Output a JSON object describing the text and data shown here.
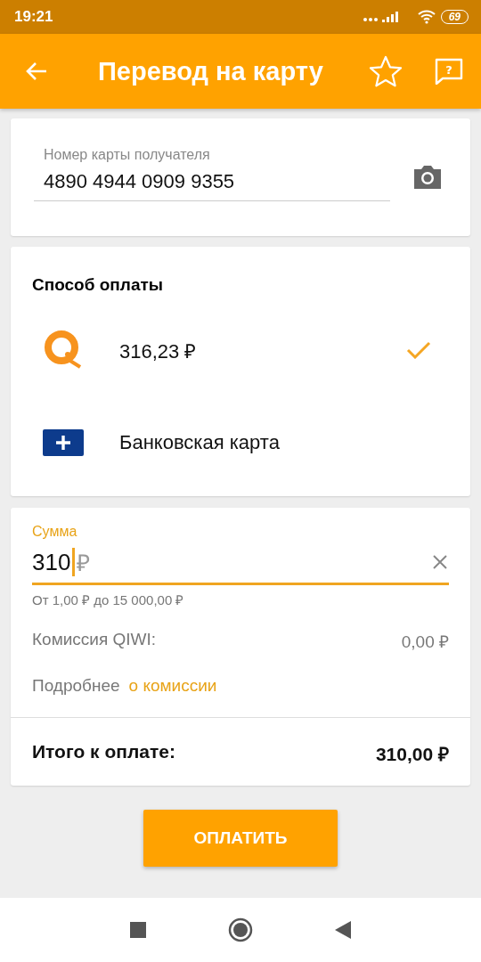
{
  "status_bar": {
    "time": "19:21",
    "battery": "69"
  },
  "app_bar": {
    "title": "Перевод на карту",
    "help_glyph": "?"
  },
  "recipient": {
    "label": "Номер карты получателя",
    "value": "4890 4944 0909 9355"
  },
  "payment": {
    "title": "Способ оплаты",
    "methods": [
      {
        "kind": "wallet",
        "label": "316,23 ₽",
        "selected": true
      },
      {
        "kind": "card",
        "label": "Банковская карта",
        "selected": false
      }
    ]
  },
  "amount": {
    "label": "Сумма",
    "value": "310",
    "currency": "₽",
    "hint": "От 1,00 ₽ до 15 000,00 ₽"
  },
  "commission": {
    "label": "Комиссия QIWI:",
    "value": "0,00 ₽"
  },
  "details": {
    "text": "Подробнее",
    "link": "о комиссии"
  },
  "total": {
    "label": "Итого к оплате:",
    "value": "310,00 ₽"
  },
  "pay_button": {
    "label": "ОПЛАТИТЬ"
  }
}
